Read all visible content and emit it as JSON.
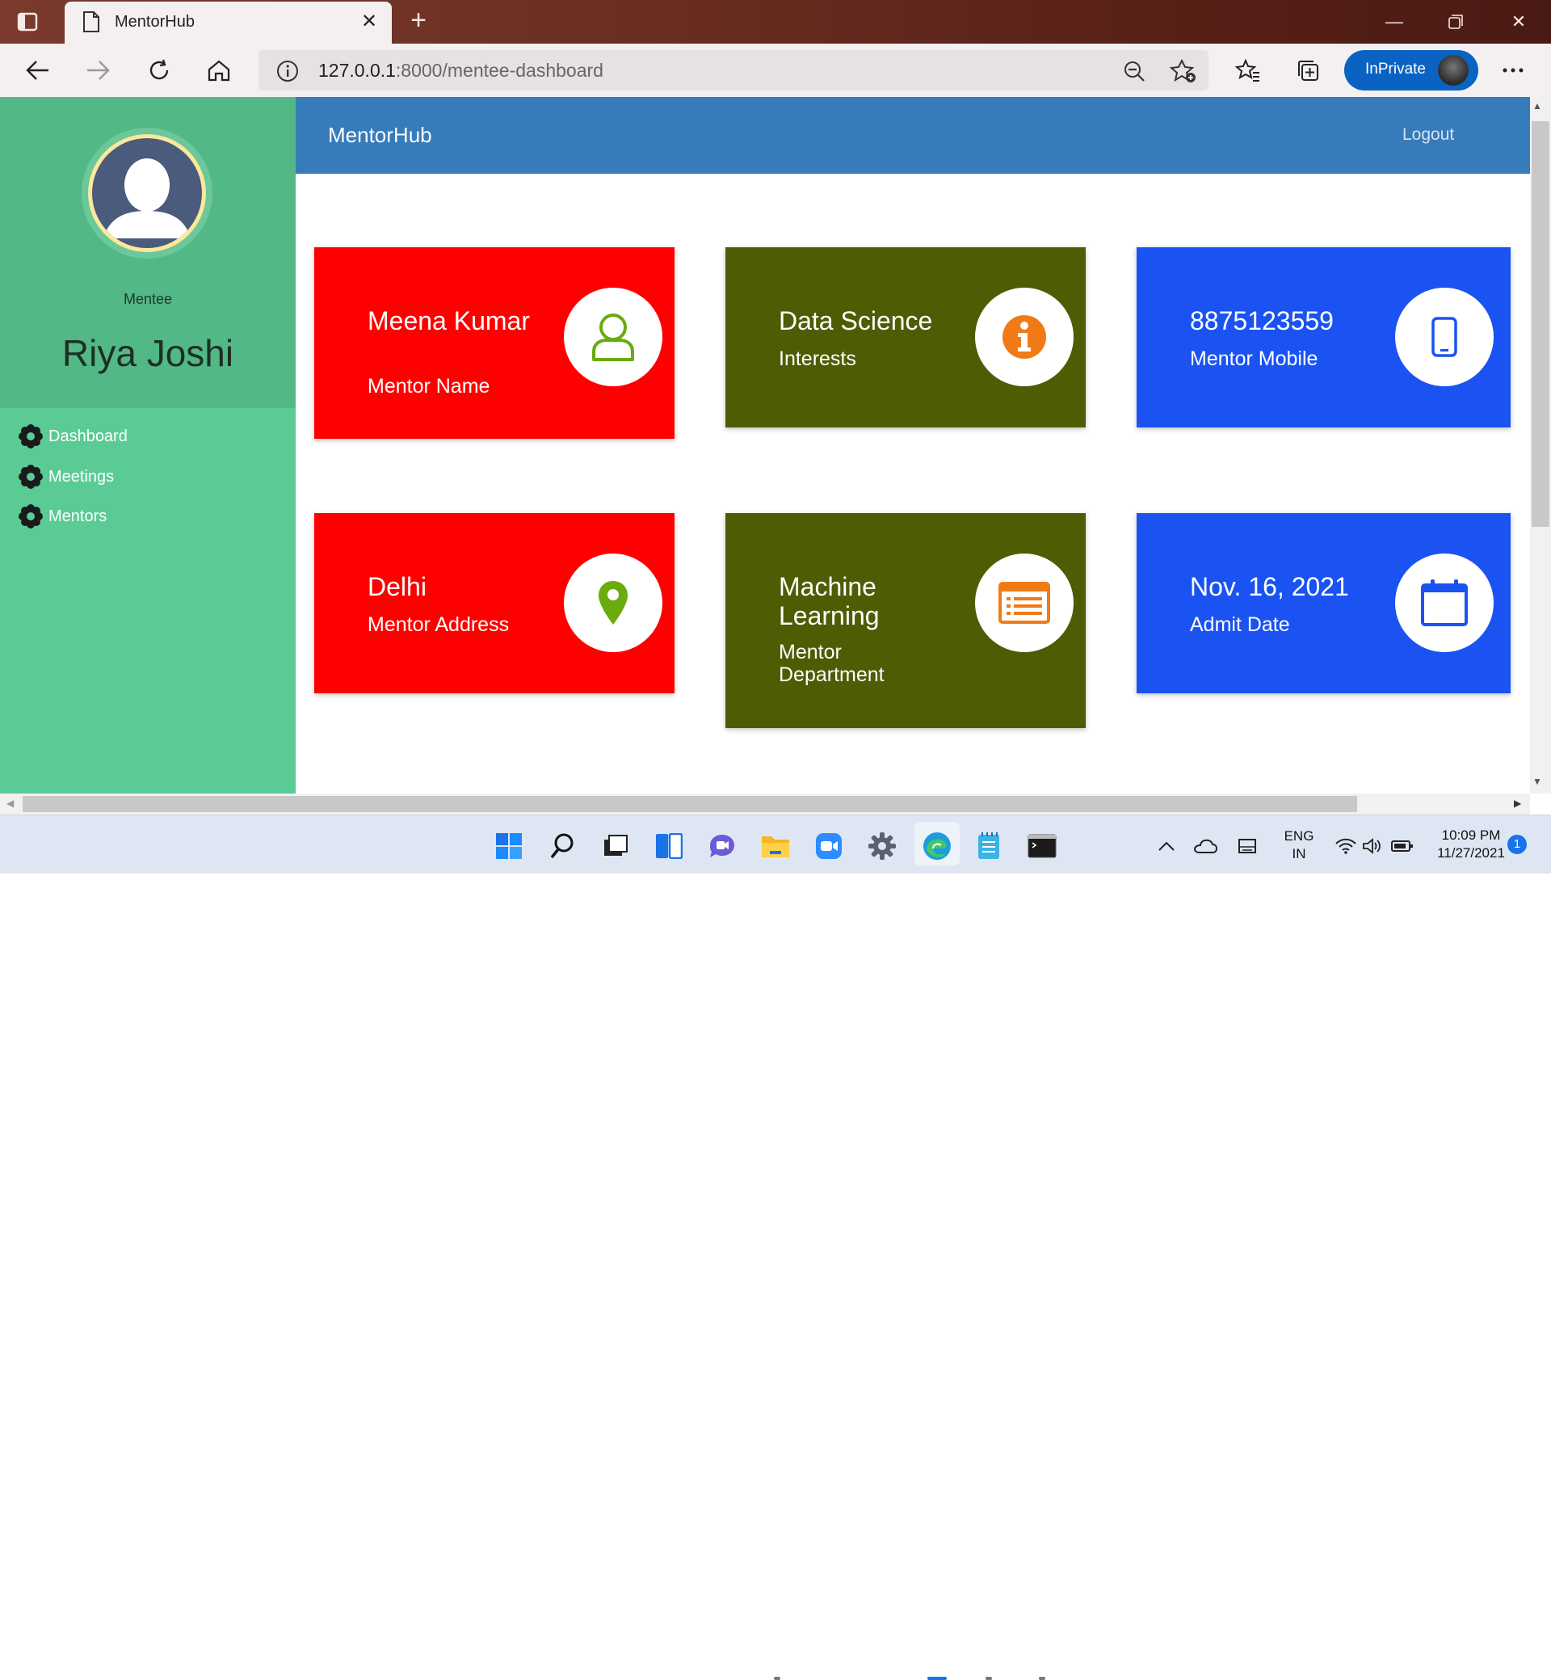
{
  "browser": {
    "tab_title": "MentorHub",
    "url_host": "127.0.0.1",
    "url_path": ":8000/mentee-dashboard",
    "inprivate_label": "InPrivate"
  },
  "sidebar": {
    "role": "Mentee",
    "user_name": "Riya Joshi",
    "menu": [
      "Dashboard",
      "Meetings",
      "Mentors"
    ]
  },
  "header": {
    "brand": "MentorHub",
    "logout": "Logout"
  },
  "cards": [
    {
      "value": "Meena Kumar",
      "label": "Mentor Name",
      "color": "#ff0000",
      "icon": "user-icon"
    },
    {
      "value": "Data Science",
      "label": "Interests",
      "color": "#4e5c04",
      "icon": "info-icon"
    },
    {
      "value": "8875123559",
      "label": "Mentor Mobile",
      "color": "#1a53f2",
      "icon": "mobile-icon"
    },
    {
      "value": "Delhi",
      "label": "Mentor Address",
      "color": "#ff0000",
      "icon": "location-pin-icon"
    },
    {
      "value": "Machine Learning",
      "label": "Mentor Department",
      "color": "#4e5c04",
      "icon": "list-icon"
    },
    {
      "value": "Nov. 16, 2021",
      "label": "Admit Date",
      "color": "#1a53f2",
      "icon": "calendar-icon"
    }
  ],
  "taskbar": {
    "lang_line1": "ENG",
    "lang_line2": "IN",
    "time": "10:09 PM",
    "date": "11/27/2021",
    "notifications": "1"
  }
}
